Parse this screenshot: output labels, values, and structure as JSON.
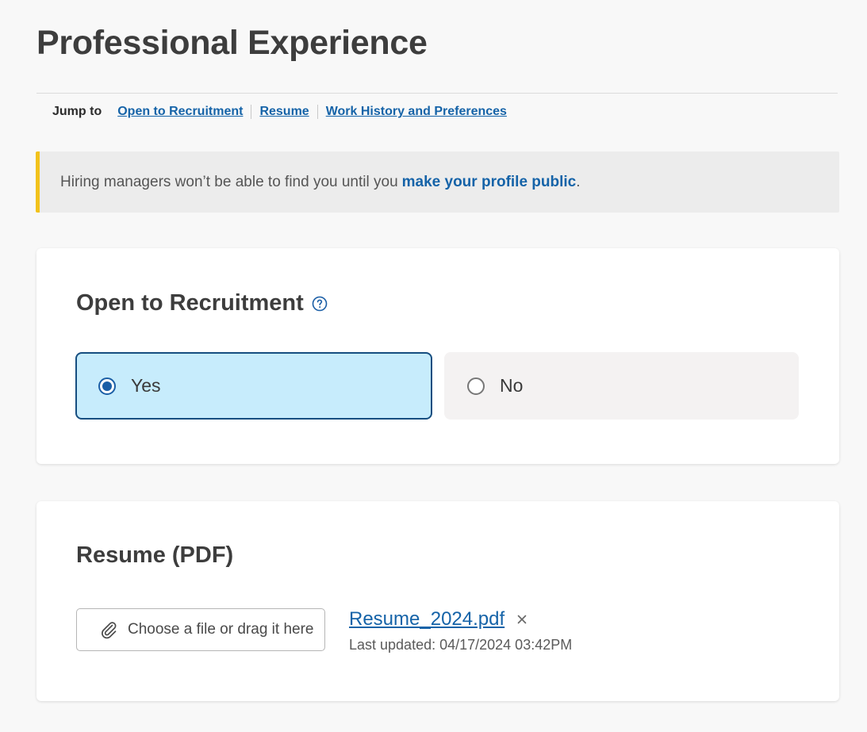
{
  "page": {
    "title": "Professional Experience"
  },
  "jump_nav": {
    "label": "Jump to",
    "links": [
      {
        "label": "Open to Recruitment"
      },
      {
        "label": "Resume"
      },
      {
        "label": "Work History and Preferences"
      }
    ]
  },
  "alert": {
    "text": "Hiring managers won’t be able to find you until you",
    "link_text": "make your profile public",
    "suffix": ".",
    "accent_color": "#f2c21b"
  },
  "recruitment": {
    "title": "Open to Recruitment",
    "help_icon": "question-circle-icon",
    "options": [
      {
        "label": "Yes",
        "selected": true
      },
      {
        "label": "No",
        "selected": false
      }
    ],
    "selected_color": "#c7ecfc"
  },
  "resume": {
    "title": "Resume (PDF)",
    "upload_label": "Choose a file or drag it here",
    "upload_icon": "paperclip-icon",
    "file_name": "Resume_2024.pdf",
    "last_updated": "Last updated: 04/17/2024 03:42PM",
    "remove_icon": "close-icon"
  },
  "colors": {
    "link": "#1563a8",
    "selected_border": "#164e80"
  }
}
